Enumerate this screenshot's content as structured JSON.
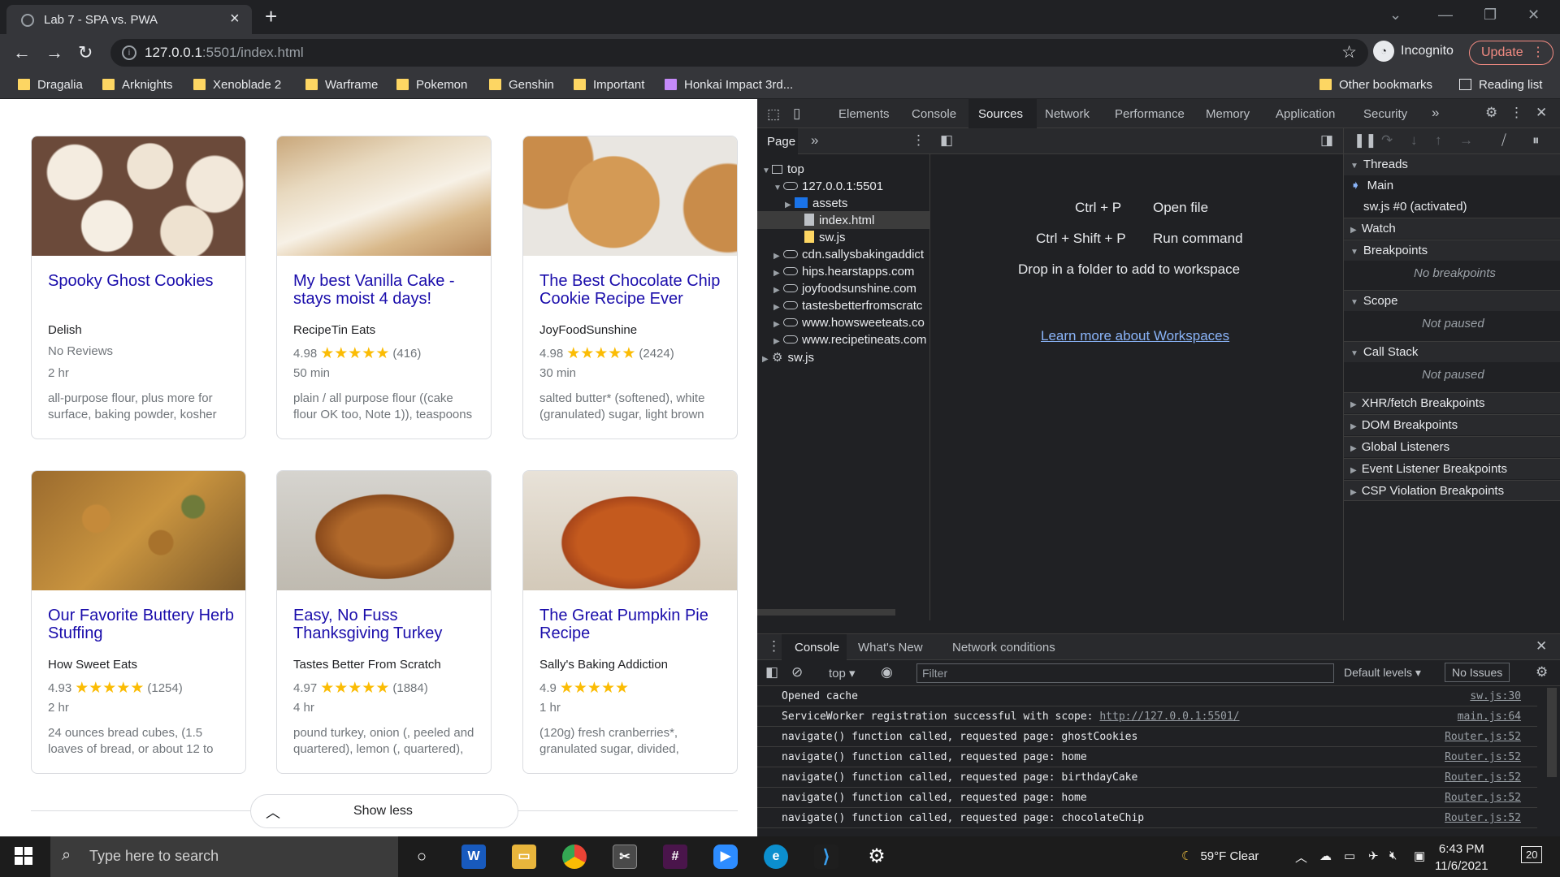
{
  "browser": {
    "tab_title": "Lab 7 - SPA vs. PWA",
    "url_host": "127.0.0.1",
    "url_path": ":5501/index.html",
    "incognito_label": "Incognito",
    "update_label": "Update",
    "bookmarks": [
      "Dragalia",
      "Arknights",
      "Xenoblade 2",
      "Warframe",
      "Pokemon",
      "Genshin",
      "Important",
      "Honkai Impact 3rd..."
    ],
    "other_bookmarks": "Other bookmarks",
    "reading_list": "Reading list"
  },
  "page": {
    "cards": [
      {
        "title": "Spooky Ghost Cookies",
        "source": "Delish",
        "rating_text": "No Reviews",
        "rating": "",
        "count": "",
        "time": "2 hr",
        "ingredients": "all-purpose flour, plus more for surface, baking powder, kosher"
      },
      {
        "title": "My best Vanilla Cake - stays moist 4 days!",
        "source": "RecipeTin Eats",
        "rating_text": "",
        "rating": "4.98",
        "count": "(416)",
        "time": "50 min",
        "ingredients": "plain / all purpose flour ((cake flour OK too, Note 1)), teaspoons"
      },
      {
        "title": "The Best Chocolate Chip Cookie Recipe Ever",
        "source": "JoyFoodSunshine",
        "rating_text": "",
        "rating": "4.98",
        "count": "(2424)",
        "time": "30 min",
        "ingredients": "salted butter* (softened), white (granulated) sugar, light brown"
      },
      {
        "title": "Our Favorite Buttery Herb Stuffing",
        "source": "How Sweet Eats",
        "rating_text": "",
        "rating": "4.93",
        "count": "(1254)",
        "time": "2 hr",
        "ingredients": "24 ounces bread cubes, (1.5 loaves of bread, or about 12 to"
      },
      {
        "title": "Easy, No Fuss Thanksgiving Turkey",
        "source": "Tastes Better From Scratch",
        "rating_text": "",
        "rating": "4.97",
        "count": "(1884)",
        "time": "4 hr",
        "ingredients": "pound turkey, onion (, peeled and quartered), lemon (, quartered),"
      },
      {
        "title": "The Great Pumpkin Pie Recipe",
        "source": "Sally's Baking Addiction",
        "rating_text": "",
        "rating": "4.9",
        "count": "",
        "time": "1 hr",
        "ingredients": "(120g) fresh cranberries*, granulated sugar, divided,"
      }
    ],
    "stars": "★★★★★",
    "show_less": "Show less"
  },
  "devtools": {
    "tabs": [
      "Elements",
      "Console",
      "Sources",
      "Network",
      "Performance",
      "Memory",
      "Application",
      "Security"
    ],
    "active_tab": "Sources",
    "nav_tab": "Page",
    "tree": {
      "top": "top",
      "origin": "127.0.0.1:5501",
      "assets": "assets",
      "index": "index.html",
      "swjs": "sw.js",
      "domains": [
        "cdn.sallysbakingaddict",
        "hips.hearstapps.com",
        "joyfoodsunshine.com",
        "tastesbetterfromscratc",
        "www.howsweeteats.co",
        "www.recipetineats.com"
      ],
      "sw_root": "sw.js"
    },
    "shortcuts": [
      {
        "keys": "Ctrl + P",
        "action": "Open file"
      },
      {
        "keys": "Ctrl + Shift + P",
        "action": "Run command"
      }
    ],
    "drop_text": "Drop in a folder to add to workspace",
    "workspace_link": "Learn more about Workspaces",
    "debugger": {
      "threads": "Threads",
      "main": "Main",
      "sw_thread": "sw.js #0 (activated)",
      "watch": "Watch",
      "breakpoints": "Breakpoints",
      "no_breakpoints": "No breakpoints",
      "scope": "Scope",
      "not_paused_1": "Not paused",
      "call_stack": "Call Stack",
      "not_paused_2": "Not paused",
      "xhr": "XHR/fetch Breakpoints",
      "dom": "DOM Breakpoints",
      "global": "Global Listeners",
      "event": "Event Listener Breakpoints",
      "csp": "CSP Violation Breakpoints"
    },
    "drawer": {
      "tabs": [
        "Console",
        "What's New",
        "Network conditions"
      ],
      "context": "top",
      "filter_placeholder": "Filter",
      "levels": "Default levels",
      "issues": "No Issues"
    },
    "logs": [
      {
        "msg": "Opened cache",
        "link": "",
        "src": "sw.js:30"
      },
      {
        "msg": "ServiceWorker registration successful with scope: ",
        "link": "http://127.0.0.1:5501/",
        "src": "main.js:64"
      },
      {
        "msg": "navigate() function called, requested page: ghostCookies",
        "link": "",
        "src": "Router.js:52"
      },
      {
        "msg": "navigate() function called, requested page: home",
        "link": "",
        "src": "Router.js:52"
      },
      {
        "msg": "navigate() function called, requested page: birthdayCake",
        "link": "",
        "src": "Router.js:52"
      },
      {
        "msg": "navigate() function called, requested page: home",
        "link": "",
        "src": "Router.js:52"
      },
      {
        "msg": "navigate() function called, requested page: chocolateChip",
        "link": "",
        "src": "Router.js:52"
      }
    ]
  },
  "taskbar": {
    "search_placeholder": "Type here to search",
    "weather": "59°F  Clear",
    "time": "6:43 PM",
    "date": "11/6/2021",
    "notifications": "20"
  }
}
